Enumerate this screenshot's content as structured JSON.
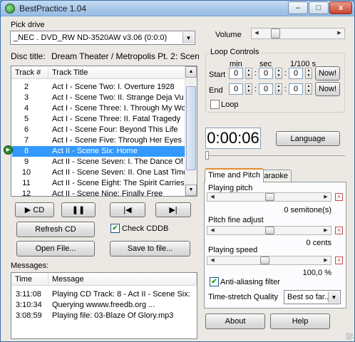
{
  "window": {
    "title": "BestPractice 1.04",
    "min_label": "–",
    "max_label": "□",
    "close_label": "x"
  },
  "drive": {
    "label": "Pick drive",
    "value": "_NEC   . DVD_RW ND-3520AW v3.06 (0:0:0)"
  },
  "volume": {
    "label": "Volume",
    "level": 0.14
  },
  "disc": {
    "label": "Disc title:",
    "value": "Dream Theater / Metropolis Pt. 2: Scenes F"
  },
  "tracklist": {
    "col_track": "Track #",
    "col_title": "Track Title",
    "playing_index": 6,
    "tracks": [
      {
        "num": "2",
        "title": "Act I - Scene Two: I. Overture 1928"
      },
      {
        "num": "3",
        "title": "Act I - Scene Two: II. Strange Deja Vu"
      },
      {
        "num": "4",
        "title": "Act I - Scene Three: I. Through My Words"
      },
      {
        "num": "5",
        "title": "Act I - Scene Three: II. Fatal Tragedy"
      },
      {
        "num": "6",
        "title": "Act I - Scene Four: Beyond This Life"
      },
      {
        "num": "7",
        "title": "Act I - Scene Five: Through Her Eyes"
      },
      {
        "num": "8",
        "title": "Act II - Scene Six: Home"
      },
      {
        "num": "9",
        "title": "Act II - Scene Seven: I. The Dance Of E..."
      },
      {
        "num": "10",
        "title": "Act II - Scene Seven: II. One Last Time"
      },
      {
        "num": "11",
        "title": "Act II - Scene Eight: The Spirit Carries On"
      },
      {
        "num": "12",
        "title": "Act II - Scene Nine: Finally Free"
      }
    ]
  },
  "transport": {
    "play_label": "▶ CD",
    "pause_label": "❚❚",
    "prev_label": "|◀",
    "next_label": "▶|"
  },
  "buttons": {
    "refresh": "Refresh CD",
    "check_cddb": "Check CDDB",
    "open_file": "Open File...",
    "save_file": "Save to file...",
    "about": "About",
    "help": "Help",
    "language": "Language",
    "now": "Now!"
  },
  "loop": {
    "group_label": "Loop Controls",
    "min_label": "min",
    "sec_label": "sec",
    "hundredths_label": "1/100 s",
    "start_label": "Start",
    "end_label": "End",
    "loop_label": "Loop",
    "start": {
      "min": "0",
      "sec": "0",
      "hs": "0"
    },
    "end": {
      "min": "0",
      "sec": "0",
      "hs": "0"
    },
    "colon": ":"
  },
  "time_display": "0:00:06",
  "position": 0.0,
  "tabs": {
    "time_pitch": "Time and Pitch",
    "karaoke": "Karaoke"
  },
  "pitch": {
    "playing_pitch_label": "Playing pitch",
    "playing_pitch_value": "0 semitone(s)",
    "playing_pitch_level": 0.5,
    "fine_label": "Pitch fine adjust",
    "fine_value": "0 cents",
    "fine_level": 0.5,
    "speed_label": "Playing speed",
    "speed_value": "100,0 %",
    "speed_level": 0.45,
    "antialias_label": "Anti-aliasing filter",
    "stretch_label": "Time-stretch Quality",
    "stretch_value": "Best so far..."
  },
  "messages": {
    "label": "Messages:",
    "col_time": "Time",
    "col_message": "Message",
    "rows": [
      {
        "time": "3:11:08",
        "message": "Playing CD Track: 8 - Act II - Scene Six: ..."
      },
      {
        "time": "3:10:34",
        "message": "Querying wwww.freedb.org ..."
      },
      {
        "time": "3:08:59",
        "message": "Playing file: 03-Blaze Of Glory.mp3"
      }
    ]
  },
  "colors": {
    "selection": "#3399ff",
    "now_button_text": "#000000",
    "play_indicator": "#2a8a2a"
  }
}
